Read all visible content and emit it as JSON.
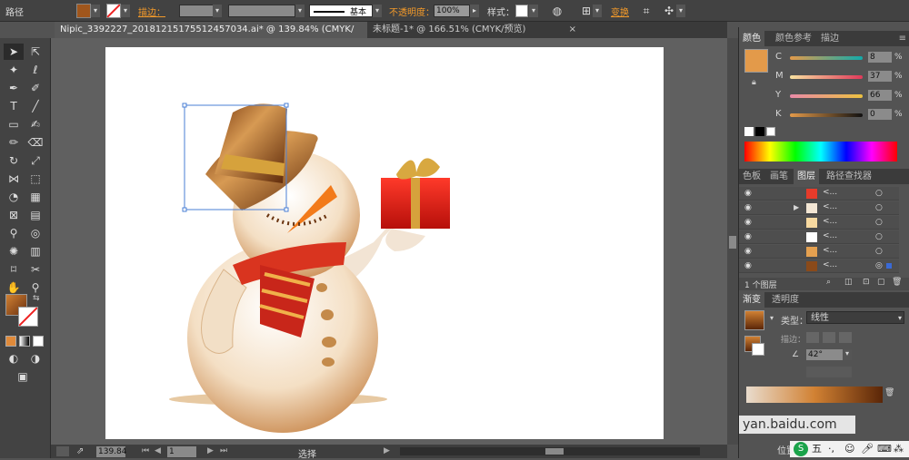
{
  "control_bar": {
    "path_label": "路径",
    "stroke_label": "描边：",
    "stroke_style_label": "基本",
    "opacity_label": "不透明度：",
    "opacity_value": "100%",
    "style_label": "样式：",
    "transform_label": "变换",
    "fill_color": "#a0561c"
  },
  "tabs": [
    {
      "label": "Nipic_3392227_20181215175512457034.ai* @ 139.84% (CMYK/预览)",
      "close": "×"
    },
    {
      "label": "未标题-1* @ 166.51% (CMYK/预览)",
      "close": "×"
    }
  ],
  "status_bar": {
    "zoom": "139.84",
    "page": "1",
    "mode": "选择"
  },
  "color_panel": {
    "tabs": [
      "颜色",
      "颜色参考",
      "描边"
    ],
    "current_color": "#e39a4a",
    "channels": [
      {
        "name": "C",
        "value": "8",
        "unit": "%"
      },
      {
        "name": "M",
        "value": "37",
        "unit": "%"
      },
      {
        "name": "Y",
        "value": "66",
        "unit": "%"
      },
      {
        "name": "K",
        "value": "0",
        "unit": "%"
      }
    ]
  },
  "layers_panel": {
    "tabs": [
      "色板",
      "画笔",
      "图层",
      "路径查找器"
    ],
    "rows": [
      {
        "name": "<..."
      },
      {
        "name": "<..."
      },
      {
        "name": "<..."
      },
      {
        "name": "<..."
      },
      {
        "name": "<..."
      },
      {
        "name": "<..."
      }
    ],
    "footer": "1 个图层"
  },
  "gradient_panel": {
    "tabs": [
      "渐变",
      "透明度"
    ],
    "type_label": "类型：",
    "type_value": "线性",
    "stroke_label": "描边：",
    "angle_value": "42°"
  },
  "watermark": {
    "text1": "yan.baidu.com",
    "text2": "位置"
  },
  "taskbar": {
    "ime": "五"
  }
}
